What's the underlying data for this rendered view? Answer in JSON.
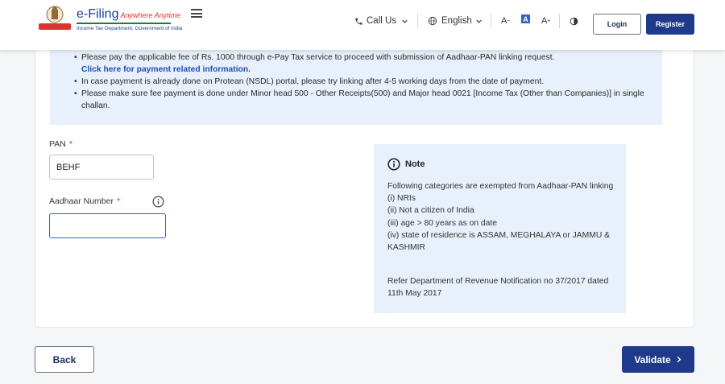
{
  "header": {
    "logo_title": "e-Filing",
    "logo_tagline": "Anywhere Anytime",
    "logo_sub": "Income Tax Department, Government of India",
    "call_us": "Call Us",
    "language": "English",
    "font_decrease": "A",
    "font_normal": "A",
    "font_increase": "A",
    "login": "Login",
    "register": "Register"
  },
  "info": {
    "line1": "Please pay the applicable fee of Rs. 1000 through e-Pay Tax service to proceed with submission of Aadhaar-PAN linking request.",
    "link": "Click here for payment related information.",
    "line2": "In case payment is already done on Protean (NSDL) portal, please try linking after 4-5 working days from the date of payment.",
    "line3": "Please make sure fee payment is done under Minor head 500 - Other Receipts(500) and Major head 0021 [Income Tax (Other than Companies)] in single challan."
  },
  "form": {
    "pan_label": "PAN",
    "pan_value": "BEHF",
    "aadhaar_label": "Aadhaar Number",
    "aadhaar_value": "",
    "required_mark": "*"
  },
  "note": {
    "title": "Note",
    "intro": "Following categories are exempted from Aadhaar-PAN linking",
    "items": [
      "(i) NRIs",
      "(ii) Not a citizen of India",
      "(iii) age > 80 years as on date",
      "(iv) state of residence is ASSAM, MEGHALAYA or JAMMU & KASHMIR"
    ],
    "reference": "Refer Department of Revenue Notification no 37/2017 dated 11th May 2017"
  },
  "footer": {
    "back": "Back",
    "validate": "Validate"
  },
  "colors": {
    "primary": "#1f3a8a",
    "info_bg": "#e8f0fb",
    "required": "#d32f2f",
    "link": "#1f4fb5"
  }
}
